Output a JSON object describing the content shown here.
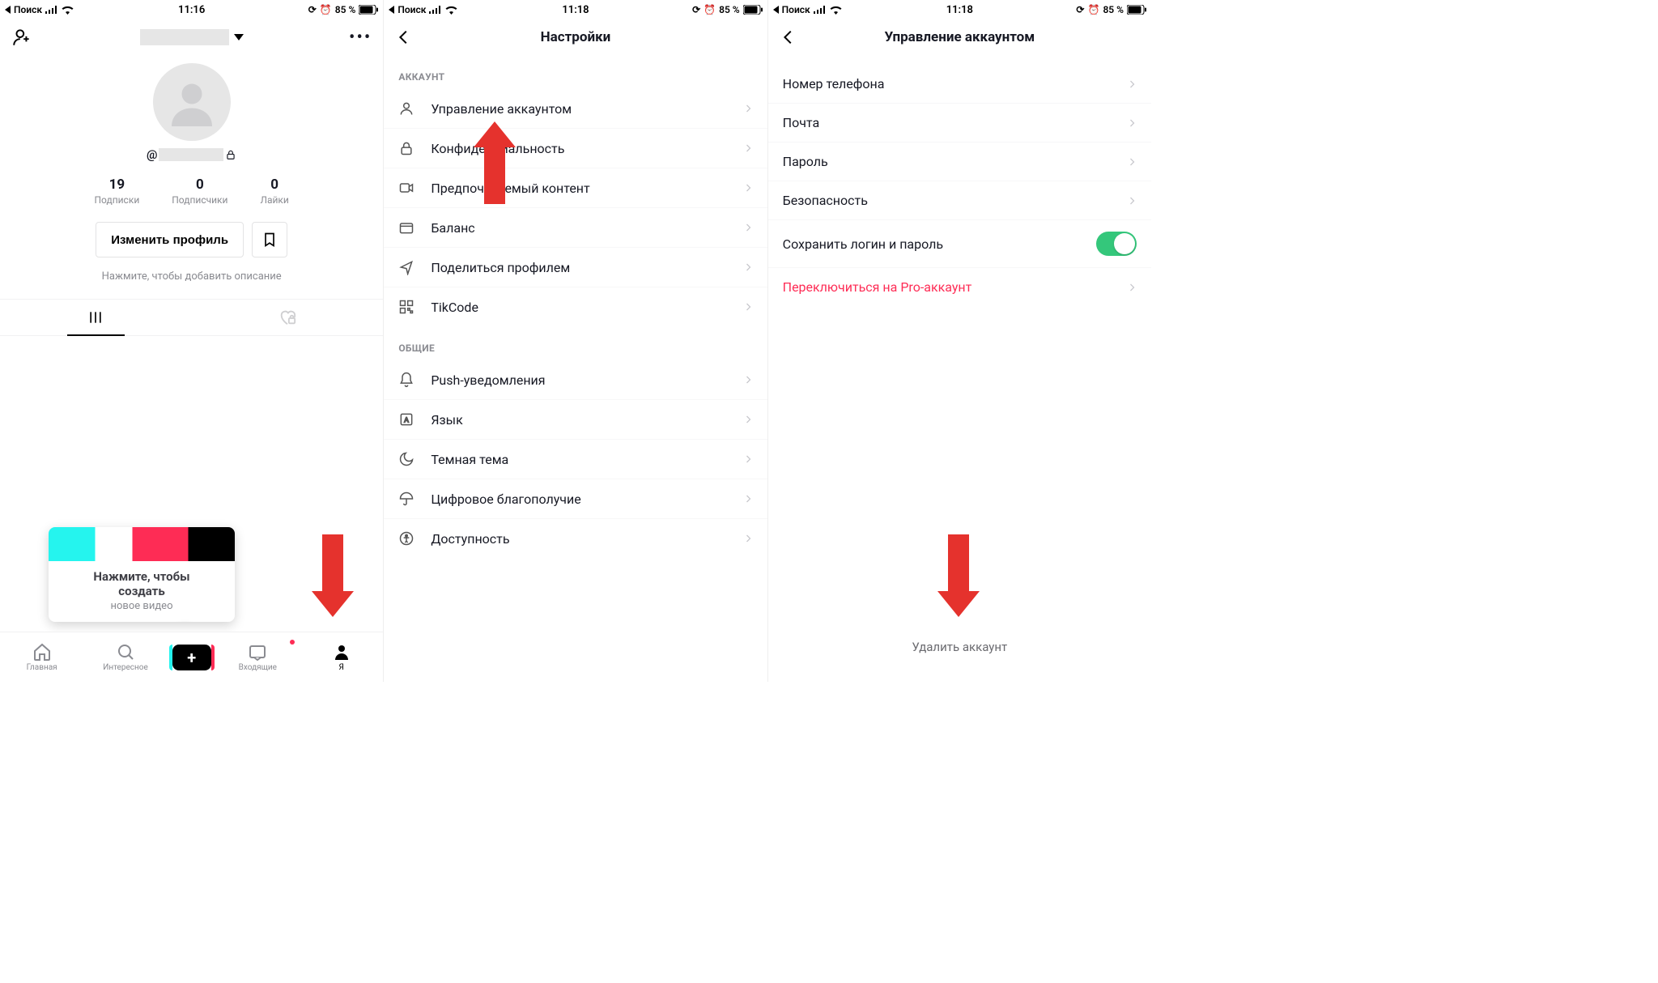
{
  "status": {
    "carrier": "Поиск",
    "battery": "85 %"
  },
  "screen1": {
    "time": "11:16",
    "username_prefix": "@",
    "stats": [
      {
        "n": "19",
        "l": "Подписки"
      },
      {
        "n": "0",
        "l": "Подписчики"
      },
      {
        "n": "0",
        "l": "Лайки"
      }
    ],
    "edit_profile": "Изменить профиль",
    "bio_hint": "Нажмите, чтобы добавить описание",
    "popup_l1a": "Нажмите, чтобы",
    "popup_l1b": "создать",
    "popup_l2": "новое видео",
    "nav": {
      "home": "Главная",
      "discover": "Интересное",
      "inbox": "Входящие",
      "me": "Я"
    }
  },
  "screen2": {
    "time": "11:18",
    "title": "Настройки",
    "section_account": "АККАУНТ",
    "section_general": "ОБЩИЕ",
    "account_items": [
      "Управление аккаунтом",
      "Конфиденциальность",
      "Предпочитаемый контент",
      "Баланс",
      "Поделиться профилем",
      "TikCode"
    ],
    "general_items": [
      "Push-уведомления",
      "Язык",
      "Темная тема",
      "Цифровое благополучие",
      "Доступность"
    ]
  },
  "screen3": {
    "time": "11:18",
    "title": "Управление аккаунтом",
    "items": [
      "Номер телефона",
      "Почта",
      "Пароль",
      "Безопасность"
    ],
    "toggle_item": "Сохранить логин и пароль",
    "pro_item": "Переключиться на Pro-аккаунт",
    "delete": "Удалить аккаунт"
  }
}
